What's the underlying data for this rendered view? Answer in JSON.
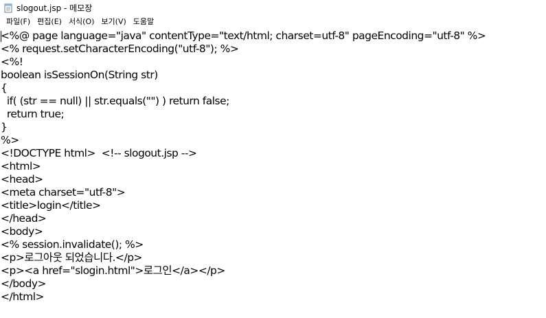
{
  "window": {
    "title": "slogout.jsp - 메모장",
    "app_icon": "notepad-icon"
  },
  "menu": [
    {
      "label": "파일(F)",
      "name": "menu-file"
    },
    {
      "label": "편집(E)",
      "name": "menu-edit"
    },
    {
      "label": "서식(O)",
      "name": "menu-format"
    },
    {
      "label": "보기(V)",
      "name": "menu-view"
    },
    {
      "label": "도움말",
      "name": "menu-help"
    }
  ],
  "document": {
    "lines": [
      "<%@ page language=\"java\" contentType=\"text/html; charset=utf-8\" pageEncoding=\"utf-8\" %>",
      "<% request.setCharacterEncoding(\"utf-8\"); %>",
      "<%!",
      "boolean isSessionOn(String str)",
      "{",
      "  if( (str == null) || str.equals(\"\") ) return false;",
      "  return true;",
      "}",
      "%>",
      "<!DOCTYPE html>  <!-- slogout.jsp -->",
      "<html>",
      "<head>",
      "<meta charset=\"utf-8\">",
      "<title>login</title>",
      "</head>",
      "<body>",
      "<% session.invalidate(); %>",
      "<p>로그아웃 되었습니다.</p>",
      "<p><a href=\"slogin.html\">로그인</a></p>",
      "</body>",
      "</html>"
    ]
  }
}
